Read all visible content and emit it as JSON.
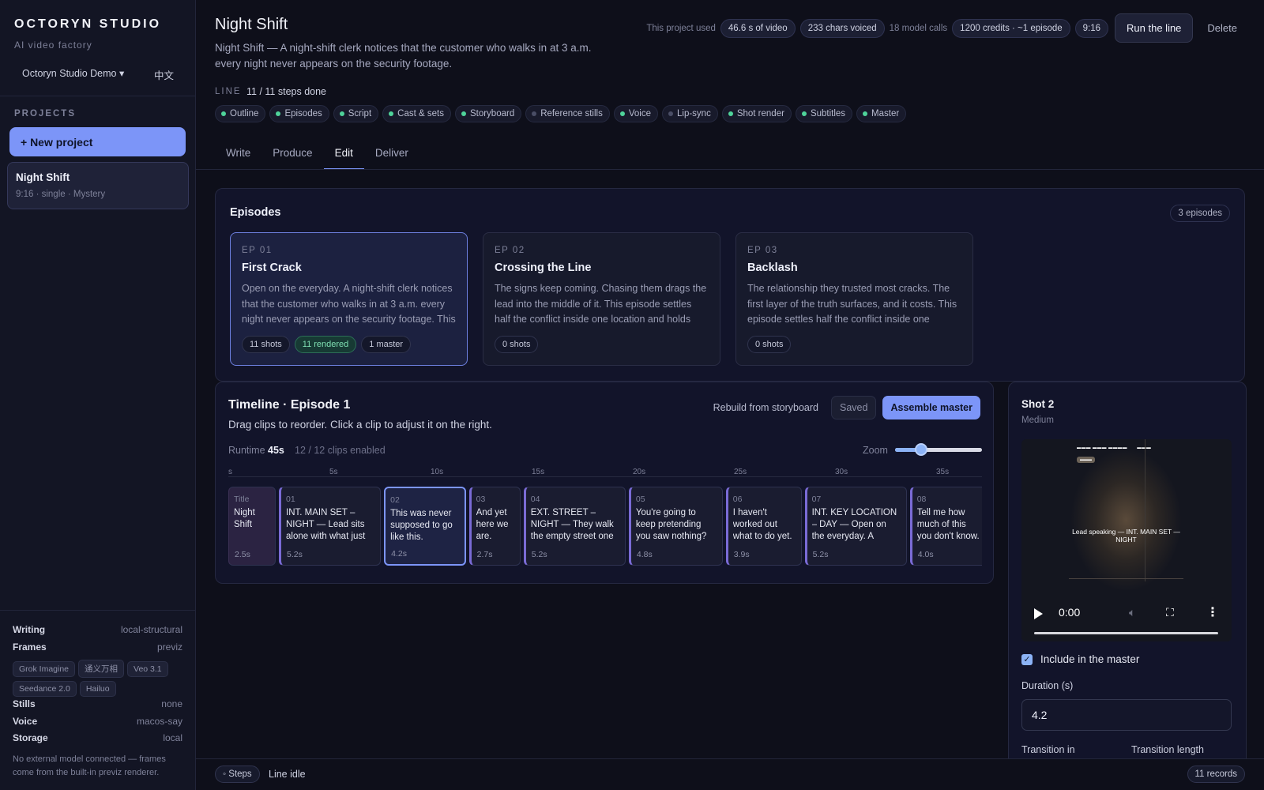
{
  "sidebar": {
    "brand": "OCTORYN STUDIO",
    "tagline": "AI video factory",
    "workspace": "Octoryn Studio Demo ▾",
    "lang": "中文",
    "projects_heading": "PROJECTS",
    "new_project": "+ New project",
    "project": {
      "title": "Night Shift",
      "meta": "9:16 · single · Mystery"
    },
    "config": {
      "writing_k": "Writing",
      "writing_v": "local-structural",
      "frames_k": "Frames",
      "frames_v": "previz",
      "frame_models": [
        "Grok Imagine",
        "通义万相",
        "Veo 3.1",
        "Seedance 2.0",
        "Hailuo"
      ],
      "stills_k": "Stills",
      "stills_v": "none",
      "voice_k": "Voice",
      "voice_v": "macos-say",
      "storage_k": "Storage",
      "storage_v": "local"
    },
    "note": "No external model connected — frames come from the built-in previz renderer."
  },
  "header": {
    "title": "Night Shift",
    "description": "Night Shift — A night-shift clerk notices that the customer who walks in at 3 a.m. every night never appears on the security footage.",
    "usage_label": "This project used",
    "video_used": "46.6 s of video",
    "chars_voiced": "233 chars voiced",
    "model_calls": "18 model calls",
    "credits": "1200 credits · ~1 episode",
    "aspect": "9:16",
    "run_button": "Run the line",
    "delete_button": "Delete",
    "line_label": "LINE",
    "line_progress": "11 / 11 steps done",
    "steps": [
      {
        "label": "Outline",
        "done": true
      },
      {
        "label": "Episodes",
        "done": true
      },
      {
        "label": "Script",
        "done": true
      },
      {
        "label": "Cast & sets",
        "done": true
      },
      {
        "label": "Storyboard",
        "done": true
      },
      {
        "label": "Reference stills",
        "done": false
      },
      {
        "label": "Voice",
        "done": true
      },
      {
        "label": "Lip-sync",
        "done": false
      },
      {
        "label": "Shot render",
        "done": true
      },
      {
        "label": "Subtitles",
        "done": true
      },
      {
        "label": "Master",
        "done": true
      }
    ],
    "tabs": [
      "Write",
      "Produce",
      "Edit",
      "Deliver"
    ],
    "active_tab": "Edit"
  },
  "episodes": {
    "heading": "Episodes",
    "count": "3 episodes",
    "items": [
      {
        "num": "EP 01",
        "title": "First Crack",
        "desc": "Open on the everyday. A night-shift clerk notices that the customer who walks in at 3 a.m. every night never appears on the security footage. This episode",
        "tags": [
          "11 shots",
          "11 rendered",
          "1 master"
        ]
      },
      {
        "num": "EP 02",
        "title": "Crossing the Line",
        "desc": "The signs keep coming. Chasing them drags the lead into the middle of it. This episode settles half the conflict inside one location and holds back",
        "tags": [
          "0 shots"
        ]
      },
      {
        "num": "EP 03",
        "title": "Backlash",
        "desc": "The relationship they trusted most cracks. The first layer of the truth surfaces, and it costs. This episode settles half the conflict inside one location",
        "tags": [
          "0 shots"
        ]
      }
    ]
  },
  "timeline": {
    "heading": "Timeline · Episode 1",
    "subheading": "Drag clips to reorder. Click a clip to adjust it on the right.",
    "rebuild": "Rebuild from storyboard",
    "saved": "Saved",
    "assemble": "Assemble master",
    "runtime_label": "Runtime",
    "runtime_value": "45s",
    "enabled": "12 / 12 clips enabled",
    "zoom_label": "Zoom",
    "zoom_level": 0.3,
    "ruler": [
      "s",
      "5s",
      "10s",
      "15s",
      "20s",
      "25s",
      "30s",
      "35s"
    ],
    "clips": [
      {
        "n": "Title",
        "text": "Night Shift",
        "dur": "2.5s",
        "kind": "title"
      },
      {
        "n": "01",
        "text": "INT. MAIN SET – NIGHT — Lead sits alone with what just happened.",
        "dur": "5.2s"
      },
      {
        "n": "02",
        "text": "This was never supposed to go like this.",
        "dur": "4.2s",
        "selected": true
      },
      {
        "n": "03",
        "text": "And yet here we are.",
        "dur": "2.7s"
      },
      {
        "n": "04",
        "text": "EXT. STREET – NIGHT — They walk the empty street one more time.",
        "dur": "5.2s"
      },
      {
        "n": "05",
        "text": "You're going to keep pretending you saw nothing?",
        "dur": "4.8s"
      },
      {
        "n": "06",
        "text": "I haven't worked out what to do yet.",
        "dur": "3.9s"
      },
      {
        "n": "07",
        "text": "INT. KEY LOCATION – DAY — Open on the everyday. A corner of the store.",
        "dur": "5.2s"
      },
      {
        "n": "08",
        "text": "Tell me how much of this you don't know.",
        "dur": "4.0s"
      }
    ]
  },
  "shot": {
    "title": "Shot 2",
    "framing": "Medium",
    "video_caption": "Lead speaking — INT. MAIN SET — NIGHT",
    "video_time": "0:00",
    "include_label": "Include in the master",
    "include_checked": true,
    "duration_label": "Duration (s)",
    "duration_value": "4.2",
    "transition_in": "Transition in",
    "transition_length": "Transition length"
  },
  "footer": {
    "steps": "◦ Steps",
    "status": "Line idle",
    "records": "11 records"
  },
  "colors": {
    "accent": "#7c95f8",
    "done": "#4fd39a",
    "pending": "#4a4e66",
    "clip_edge": "#7a6bd6"
  }
}
